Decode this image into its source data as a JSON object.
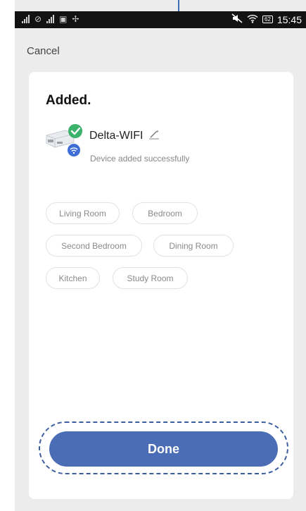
{
  "status_bar": {
    "time": "15:45",
    "battery": "62"
  },
  "header": {
    "cancel_label": "Cancel"
  },
  "card": {
    "title": "Added.",
    "device": {
      "name": "Delta-WIFI",
      "status": "Device added successfully"
    },
    "rooms": [
      "Living Room",
      "Bedroom",
      "Second Bedroom",
      "Dining Room",
      "Kitchen",
      "Study Room"
    ],
    "done_label": "Done"
  },
  "colors": {
    "accent": "#4a6db5",
    "success": "#3bb26a",
    "wifi_badge": "#3f6fd6",
    "status_bar": "#121212",
    "background": "#ececec"
  },
  "icons": [
    "signal-icon",
    "wifi-icon",
    "image-icon",
    "fan-icon",
    "mute-icon",
    "battery-icon",
    "check-badge-icon",
    "edit-pencil-icon"
  ]
}
